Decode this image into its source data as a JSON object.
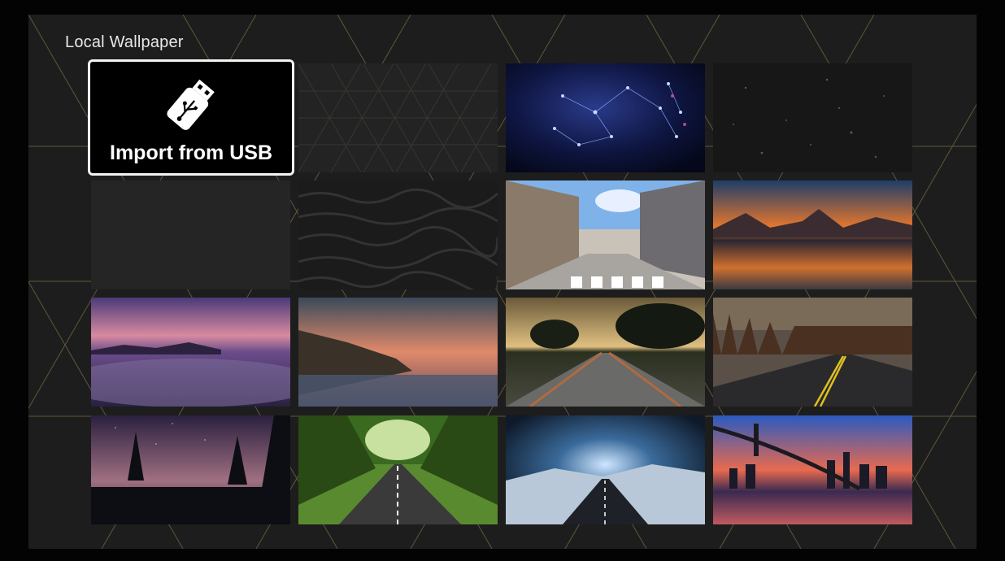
{
  "page": {
    "title": "Local Wallpaper"
  },
  "import_tile": {
    "label": "Import from USB",
    "icon": "usb-drive-icon"
  },
  "wallpapers": [
    {
      "name": "dark-geometric-pattern"
    },
    {
      "name": "blue-network-constellation"
    },
    {
      "name": "dark-bokeh-particles"
    },
    {
      "name": "dark-grunge-texture"
    },
    {
      "name": "black-wave-texture"
    },
    {
      "name": "anime-city-street"
    },
    {
      "name": "mountain-lake-sunset"
    },
    {
      "name": "purple-cloud-sea"
    },
    {
      "name": "coastal-cliff-sunset"
    },
    {
      "name": "railway-tracks-sunset"
    },
    {
      "name": "forest-road-curve"
    },
    {
      "name": "night-sky-lake-trees"
    },
    {
      "name": "tree-tunnel-road"
    },
    {
      "name": "snowy-road-horizon"
    },
    {
      "name": "bridge-city-sunset"
    }
  ],
  "colors": {
    "accent_line": "#8a7a4a",
    "background": "#1d1d1d",
    "focus_border": "#f2f2f2"
  }
}
